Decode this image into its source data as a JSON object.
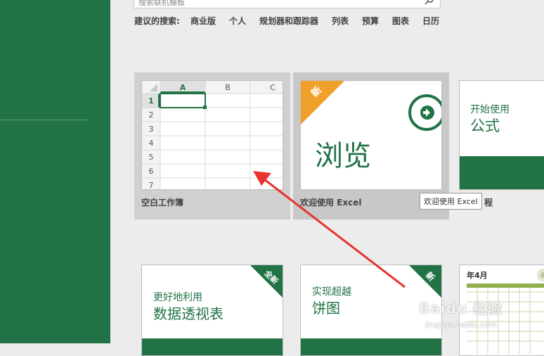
{
  "search": {
    "placeholder": "搜索联机模板"
  },
  "suggested": {
    "label": "建议的搜索:",
    "items": [
      "商业版",
      "个人",
      "规划器和跟踪器",
      "列表",
      "预算",
      "图表",
      "日历"
    ]
  },
  "blank_workbook": {
    "label": "空白工作簿",
    "columns": [
      "A",
      "B",
      "C"
    ],
    "rows": [
      "1",
      "2",
      "3",
      "4",
      "5",
      "6",
      "7"
    ]
  },
  "welcome_template": {
    "label": "欢迎使用 Excel",
    "badge": "新",
    "title": "浏览"
  },
  "formula_template": {
    "line1": "开始使用",
    "line2": "公式"
  },
  "tooltip": {
    "text": "欢迎使用 Excel",
    "after": "程"
  },
  "pivot_template": {
    "badge": "全新",
    "line1": "更好地利用",
    "line2": "数据透视表"
  },
  "pie_template": {
    "badge": "新",
    "line1": "实现超越",
    "line2": "饼图"
  },
  "calendar_template": {
    "title": "年4月"
  },
  "watermark": {
    "main": "Baidu 经验",
    "sub": "jingyan.baidu.com"
  },
  "colors": {
    "brand_green": "#217346",
    "badge_orange": "#f0a12a",
    "arrow_red": "#e8332f"
  }
}
